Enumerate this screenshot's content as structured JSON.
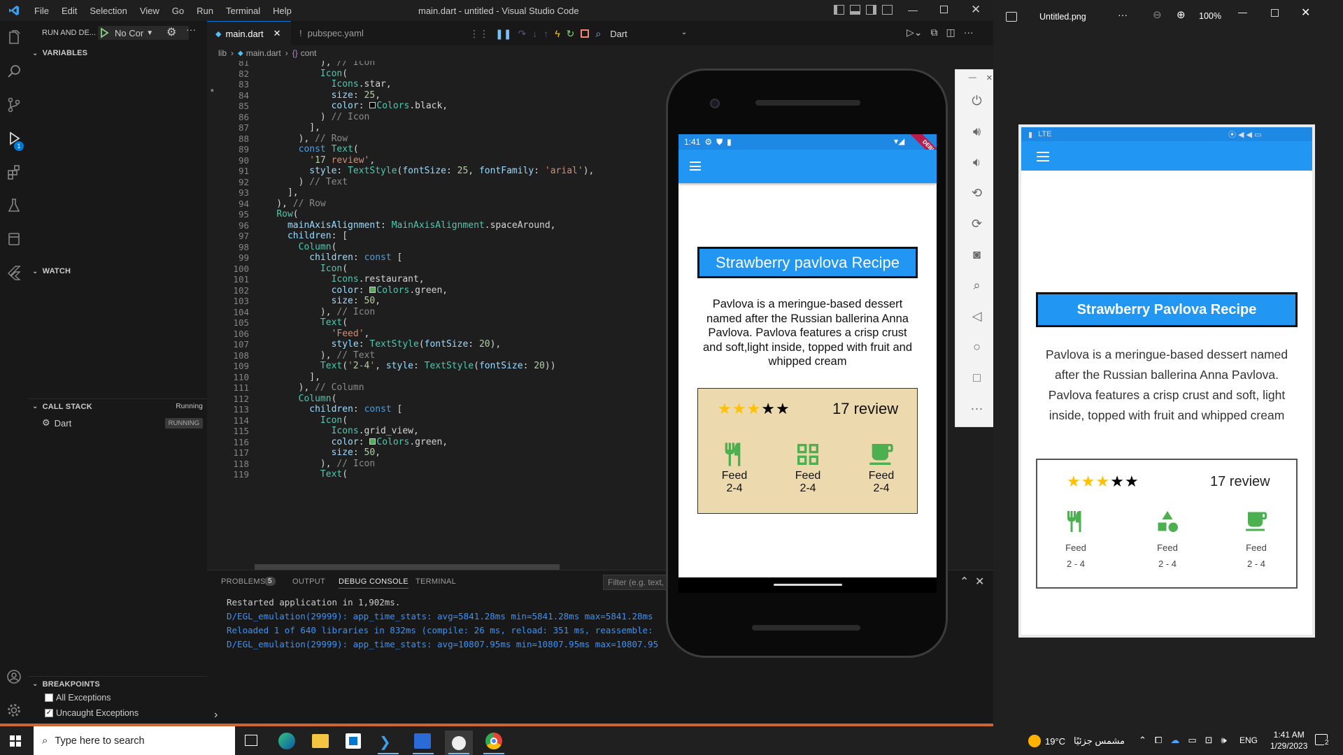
{
  "window": {
    "title": "main.dart - untitled - Visual Studio Code",
    "menu": [
      "File",
      "Edit",
      "Selection",
      "View",
      "Go",
      "Run",
      "Terminal",
      "Help"
    ]
  },
  "sidebar": {
    "run_label": "RUN AND DE...",
    "config": "No Cor",
    "variables": "VARIABLES",
    "watch": "WATCH",
    "callstack": "CALL STACK",
    "callstack_status": "Running",
    "thread": "Dart",
    "thread_status": "RUNNING",
    "breakpoints": "BREAKPOINTS",
    "bp_items": [
      {
        "label": "All Exceptions",
        "checked": false
      },
      {
        "label": "Uncaught Exceptions",
        "checked": true
      }
    ],
    "debug_badge": "1"
  },
  "tabs": [
    {
      "label": "main.dart",
      "active": true
    },
    {
      "label": "pubspec.yaml",
      "active": false
    }
  ],
  "debug_toolbar": {
    "target": "Dart"
  },
  "breadcrumb": [
    "lib",
    "main.dart",
    "cont"
  ],
  "code_lines": [
    {
      "n": "81",
      "t": "            ), // Icon"
    },
    {
      "n": "82",
      "t": "            Icon("
    },
    {
      "n": "83",
      "t": "              Icons.star,"
    },
    {
      "n": "84",
      "t": "              size: 25,"
    },
    {
      "n": "85",
      "t": "              color: ▢Colors.black,"
    },
    {
      "n": "86",
      "t": "            ) // Icon"
    },
    {
      "n": "87",
      "t": "          ],"
    },
    {
      "n": "88",
      "t": "        ), // Row"
    },
    {
      "n": "89",
      "t": "        const Text("
    },
    {
      "n": "90",
      "t": "          '17 review',"
    },
    {
      "n": "91",
      "t": "          style: TextStyle(fontSize: 25, fontFamily: 'arial'),"
    },
    {
      "n": "92",
      "t": "        ) // Text"
    },
    {
      "n": "93",
      "t": "      ],"
    },
    {
      "n": "94",
      "t": "    ), // Row"
    },
    {
      "n": "95",
      "t": "    Row("
    },
    {
      "n": "96",
      "t": "      mainAxisAlignment: MainAxisAlignment.spaceAround,"
    },
    {
      "n": "97",
      "t": "      children: ["
    },
    {
      "n": "98",
      "t": "        Column("
    },
    {
      "n": "99",
      "t": "          children: const ["
    },
    {
      "n": "100",
      "t": "            Icon("
    },
    {
      "n": "101",
      "t": "              Icons.restaurant,"
    },
    {
      "n": "102",
      "t": "              color: ■Colors.green,"
    },
    {
      "n": "103",
      "t": "              size: 50,"
    },
    {
      "n": "104",
      "t": "            ), // Icon"
    },
    {
      "n": "105",
      "t": "            Text("
    },
    {
      "n": "106",
      "t": "              'Feed',"
    },
    {
      "n": "107",
      "t": "              style: TextStyle(fontSize: 20),"
    },
    {
      "n": "108",
      "t": "            ), // Text"
    },
    {
      "n": "109",
      "t": "            Text('2-4', style: TextStyle(fontSize: 20))"
    },
    {
      "n": "110",
      "t": "          ],"
    },
    {
      "n": "111",
      "t": "        ), // Column"
    },
    {
      "n": "112",
      "t": "        Column("
    },
    {
      "n": "113",
      "t": "          children: const ["
    },
    {
      "n": "114",
      "t": "            Icon("
    },
    {
      "n": "115",
      "t": "              Icons.grid_view,"
    },
    {
      "n": "116",
      "t": "              color: ■Colors.green,"
    },
    {
      "n": "117",
      "t": "              size: 50,"
    },
    {
      "n": "118",
      "t": "            ), // Icon"
    },
    {
      "n": "119",
      "t": "            Text("
    }
  ],
  "panel": {
    "tabs": [
      "PROBLEMS",
      "OUTPUT",
      "DEBUG CONSOLE",
      "TERMINAL"
    ],
    "problems_count": "5",
    "filter_placeholder": "Filter (e.g. text, !",
    "console": [
      "Restarted application in 1,902ms.",
      "D/EGL_emulation(29999): app_time_stats: avg=5841.28ms min=5841.28ms max=5841.28ms",
      "Reloaded 1 of 640 libraries in 832ms (compile: 26 ms, reload: 351 ms, reassemble:",
      "D/EGL_emulation(29999): app_time_stats: avg=10807.95ms min=10807.95ms max=10807.95"
    ]
  },
  "phone": {
    "time": "1:41",
    "debug_ribbon": "DEBUG",
    "title": "Strawberry pavlova Recipe",
    "description": "Pavlova is a meringue-based dessert named after the Russian ballerina Anna Pavlova. Pavlova features a crisp crust and soft,light inside, topped with fruit and whipped cream",
    "review": "17 review",
    "stars_gold": 3,
    "stars_total": 5,
    "feeds": [
      {
        "label": "Feed",
        "value": "2-4",
        "icon": "restaurant-icon"
      },
      {
        "label": "Feed",
        "value": "2-4",
        "icon": "grid-view-icon"
      },
      {
        "label": "Feed",
        "value": "2-4",
        "icon": "coffee-icon"
      }
    ]
  },
  "viewer": {
    "filename": "Untitled.png",
    "zoom": "100%",
    "status_text": "LTE",
    "title": "Strawberry Pavlova Recipe",
    "description": "Pavlova is a meringue-based dessert named after the Russian ballerina Anna Pavlova. Pavlova features a crisp crust and soft, light inside, topped with fruit and whipped cream",
    "review": "17 review",
    "feeds": [
      {
        "label": "Feed",
        "value": "2 - 4"
      },
      {
        "label": "Feed",
        "value": "2 - 4"
      },
      {
        "label": "Feed",
        "value": "2 - 4"
      }
    ]
  },
  "taskbar": {
    "search_placeholder": "Type here to search",
    "weather": "19°C",
    "weather_text": "مشمس جزئيًا",
    "lang": "ENG",
    "time": "1:41 AM",
    "date": "1/29/2023",
    "notif": "2"
  },
  "colors": {
    "accent": "#2196f3",
    "green": "#4caf50",
    "gold": "#ffc107",
    "card": "#ecd9ad"
  }
}
